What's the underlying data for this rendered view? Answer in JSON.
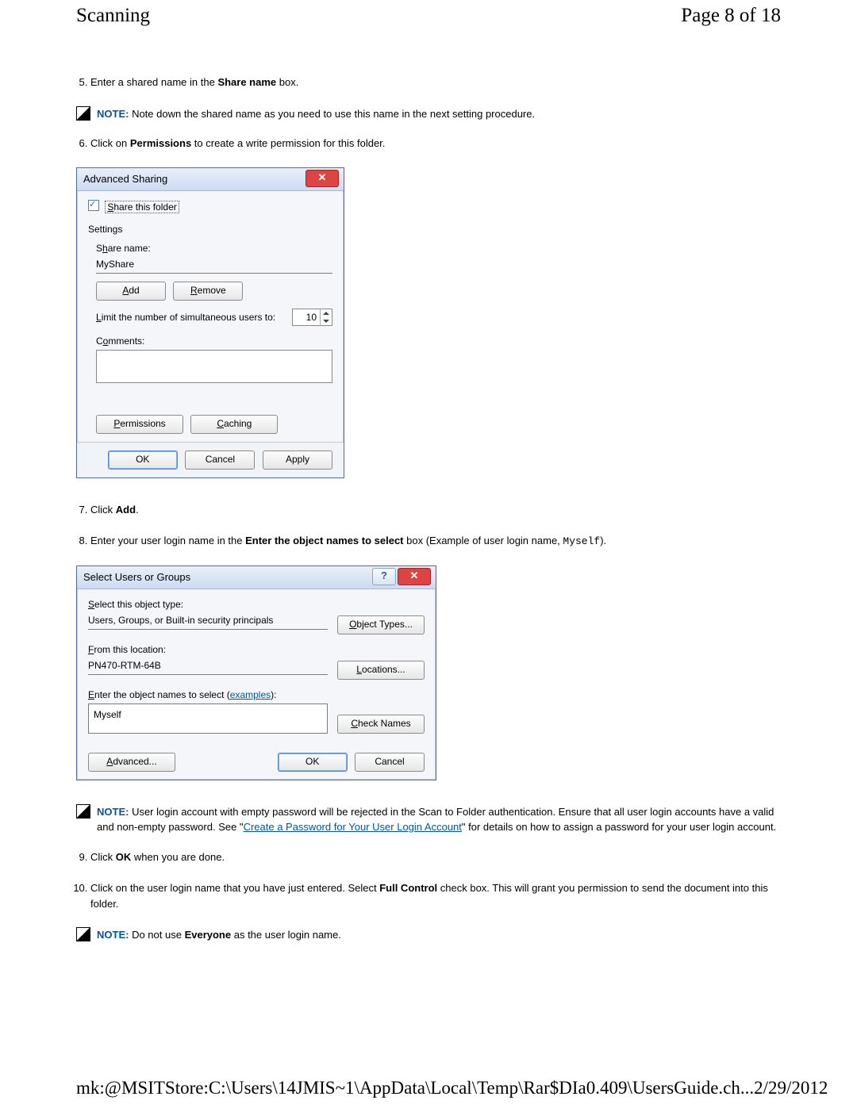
{
  "header": {
    "title": "Scanning",
    "page_label": "Page 8 of 18"
  },
  "steps": {
    "s5": {
      "num": "5.",
      "prefix": "Enter a shared name in the ",
      "bold": "Share name",
      "suffix": " box."
    },
    "note1": {
      "label": "NOTE:",
      "text": " Note down the shared name as you need to use this name in the next setting procedure."
    },
    "s6": {
      "num": "6.",
      "prefix": "Click on ",
      "bold": "Permissions",
      "suffix": " to create a write permission for this folder."
    },
    "s7": {
      "num": "7.",
      "prefix": "Click ",
      "bold": "Add",
      "suffix": "."
    },
    "s8": {
      "num": "8.",
      "prefix": "Enter your user login name in the ",
      "bold": "Enter the object names to select",
      "mid": " box (Example of user login name, ",
      "mono": "Myself",
      "suffix": ")."
    },
    "note2": {
      "label": "NOTE:",
      "t1": " User login account with empty password will be rejected in the Scan to Folder authentication. Ensure that all user login accounts have a valid and non-empty password. See \"",
      "link": "Create a Password for Your User Login Account",
      "t2": "\" for details on how to assign a password for your user login account."
    },
    "s9": {
      "num": "9.",
      "prefix": "Click ",
      "bold": "OK",
      "suffix": " when you are done."
    },
    "s10": {
      "num": "10.",
      "prefix": "Click on the user login name that you have just entered. Select ",
      "bold": "Full Control",
      "suffix": " check box. This will grant you permission to send the document into this folder."
    },
    "note3": {
      "label": "NOTE:",
      "t1": " Do not use ",
      "bold": "Everyone",
      "t2": " as the user login name."
    }
  },
  "adv": {
    "title": "Advanced Sharing",
    "share_this": "Share this folder",
    "settings": "Settings",
    "share_name_label": "Share name:",
    "share_name_value": "MyShare",
    "add": "Add",
    "remove": "Remove",
    "limit_label": "Limit the number of simultaneous users to:",
    "limit_value": "10",
    "comments_label": "Comments:",
    "permissions": "Permissions",
    "caching": "Caching",
    "ok": "OK",
    "cancel": "Cancel",
    "apply": "Apply"
  },
  "sel": {
    "title": "Select Users or Groups",
    "obj_type_label": "Select this object type:",
    "obj_type_value": "Users, Groups, or Built-in security principals",
    "obj_types_btn": "Object Types...",
    "location_label": "From this location:",
    "location_value": "PN470-RTM-64B",
    "locations_btn": "Locations...",
    "names_label_a": "Enter the object names to select (",
    "names_link": "examples",
    "names_label_b": "):",
    "names_value": "Myself",
    "check_names": "Check Names",
    "advanced": "Advanced...",
    "ok": "OK",
    "cancel": "Cancel"
  },
  "footer": {
    "path": "mk:@MSITStore:C:\\Users\\14JMIS~1\\AppData\\Local\\Temp\\Rar$DIa0.409\\UsersGuide.ch...",
    "date": "2/29/2012"
  }
}
